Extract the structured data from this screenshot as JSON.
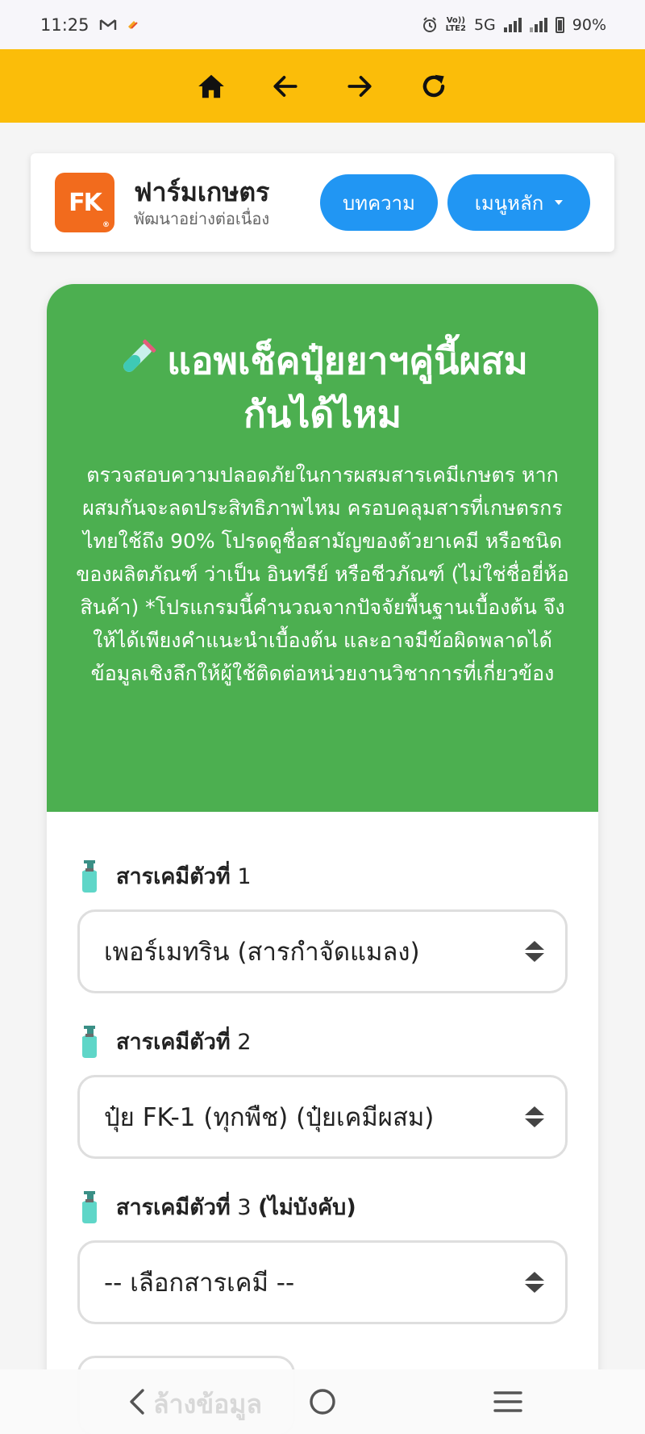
{
  "status_bar": {
    "time": "11:25",
    "network_label_top": "Vo))",
    "network_label_bottom": "LTE2",
    "network_type": "5G",
    "battery": "90%"
  },
  "toolbar": {
    "home_icon": "home-icon",
    "back_icon": "arrow-left-icon",
    "forward_icon": "arrow-right-icon",
    "reload_icon": "reload-icon",
    "background_color": "#fbbd09"
  },
  "site_header": {
    "logo_text": "FK",
    "logo_reg": "®",
    "brand_name": "ฟาร์มเกษตร",
    "tagline": "พัฒนาอย่างต่อเนื่อง",
    "articles_label": "บทความ",
    "menu_label": "เมนูหลัก",
    "button_color": "#2196f3"
  },
  "hero": {
    "title_line1": "แอพเช็คปุ๋ยยาฯคู่นี้ผสม",
    "title_line2": "กันได้ไหม",
    "description": "ตรวจสอบความปลอดภัยในการผสมสารเคมีเกษตร หากผสมกันจะลดประสิทธิภาพไหม ครอบคลุมสารที่เกษตรกรไทยใช้ถึง 90% โปรดดูชื่อสามัญของตัวยาเคมี หรือชนิดของผลิตภัณฑ์ ว่าเป็น อินทรีย์ หรือชีวภัณฑ์ (ไม่ใช่ชื่อยี่ห้อสินค้า) *โปรแกรมนี้คำนวณจากปัจจัยพื้นฐานเบื้องต้น จึงให้ได้เพียงคำแนะนำเบื้องต้น และอาจมีข้อผิดพลาดได้ ข้อมูลเชิงลึกให้ผู้ใช้ติดต่อหน่วยงานวิชาการที่เกี่ยวข้อง",
    "background_color": "#4caf50"
  },
  "fields": [
    {
      "label_bold": "สารเคมีตัวที่",
      "label_rest": " 1",
      "value": "เพอร์เมทริน (สารกำจัดแมลง)"
    },
    {
      "label_bold": "สารเคมีตัวที่",
      "label_rest": " 2",
      "value": "ปุ๋ย FK-1 (ทุกพืช) (ปุ๋ยเคมีผสม)"
    },
    {
      "label_bold": "สารเคมีตัวที่",
      "label_rest": " 3 ",
      "label_paren": "(ไม่บังคับ)",
      "value": "-- เลือกสารเคมี --"
    }
  ],
  "partial_button_text": "ล้างข้อมูล",
  "navbar": {
    "back_icon": "chevron-left-icon",
    "home_icon": "circle-home-icon",
    "recents_icon": "menu-lines-icon"
  }
}
